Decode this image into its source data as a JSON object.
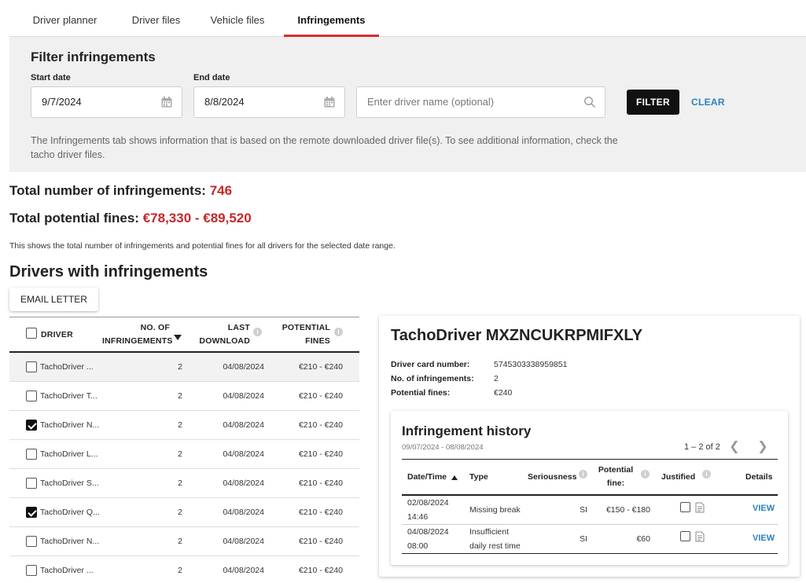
{
  "tabs": [
    {
      "label": "Driver planner"
    },
    {
      "label": "Driver files"
    },
    {
      "label": "Vehicle files"
    },
    {
      "label": "Infringements"
    }
  ],
  "active_tab": "Infringements",
  "filter": {
    "title": "Filter infringements",
    "start_label": "Start date",
    "start_value": "9/7/2024",
    "end_label": "End date",
    "end_value": "8/8/2024",
    "driver_placeholder": "Enter driver name (optional)",
    "filter_button": "FILTER",
    "clear_button": "CLEAR",
    "note": "The Infringements tab shows information that is based on the remote downloaded driver file(s). To see additional information, check the tacho driver files."
  },
  "totals": {
    "infringements_label": "Total number of infringements:",
    "infringements_value": "746",
    "fines_label": "Total potential fines:",
    "fines_value": "€78,330 - €89,520",
    "note": "This shows the total number of infringements and potential fines for all drivers for the selected date range."
  },
  "drivers": {
    "title": "Drivers with infringements",
    "email_button": "EMAIL LETTER",
    "headers": {
      "driver": "DRIVER",
      "count_line1": "NO. OF",
      "count_line2": "INFRINGEMENTS",
      "last_line1": "LAST",
      "last_line2": "DOWNLOAD",
      "fines_line1": "POTENTIAL",
      "fines_line2": "FINES"
    },
    "rows": [
      {
        "name": "TachoDriver ...",
        "count": "2",
        "last": "04/08/2024",
        "fines": "€210 - €240",
        "checked": false,
        "highlight": true
      },
      {
        "name": "TachoDriver T...",
        "count": "2",
        "last": "04/08/2024",
        "fines": "€210 - €240",
        "checked": false,
        "highlight": false
      },
      {
        "name": "TachoDriver N...",
        "count": "2",
        "last": "04/08/2024",
        "fines": "€210 - €240",
        "checked": true,
        "highlight": false
      },
      {
        "name": "TachoDriver L...",
        "count": "2",
        "last": "04/08/2024",
        "fines": "€210 - €240",
        "checked": false,
        "highlight": false
      },
      {
        "name": "TachoDriver S...",
        "count": "2",
        "last": "04/08/2024",
        "fines": "€210 - €240",
        "checked": false,
        "highlight": false
      },
      {
        "name": "TachoDriver Q...",
        "count": "2",
        "last": "04/08/2024",
        "fines": "€210 - €240",
        "checked": true,
        "highlight": false
      },
      {
        "name": "TachoDriver N...",
        "count": "2",
        "last": "04/08/2024",
        "fines": "€210 - €240",
        "checked": false,
        "highlight": false
      },
      {
        "name": "TachoDriver ...",
        "count": "2",
        "last": "04/08/2024",
        "fines": "€210 - €240",
        "checked": false,
        "highlight": false
      }
    ]
  },
  "detail": {
    "title": "TachoDriver MXZNCUKRPMIFXLY",
    "card_label": "Driver card number:",
    "card_value": "5745303338959851",
    "count_label": "No. of infringements:",
    "count_value": "2",
    "fines_label": "Potential fines:",
    "fines_value": "€240",
    "history": {
      "title": "Infringement history",
      "range": "09/07/2024 - 08/08/2024",
      "pager": "1 – 2 of 2",
      "headers": {
        "date": "Date/Time",
        "type": "Type",
        "seriousness": "Seriousness",
        "fine_line1": "Potential",
        "fine_line2": "fine:",
        "justified": "Justified",
        "details": "Details"
      },
      "rows": [
        {
          "date": "02/08/2024",
          "time": "14:46",
          "type_line1": "Missing break",
          "type_line2": "",
          "seriousness": "SI",
          "fine": "€150 - €180",
          "view": "VIEW"
        },
        {
          "date": "04/08/2024",
          "time": "08:00",
          "type_line1": "Insufficient",
          "type_line2": "daily rest time",
          "seriousness": "SI",
          "fine": "€60",
          "view": "VIEW"
        }
      ]
    }
  },
  "colors": {
    "accent_red": "#c62828",
    "link_blue": "#2a80c1",
    "filter_bg": "#f0f0f0"
  }
}
